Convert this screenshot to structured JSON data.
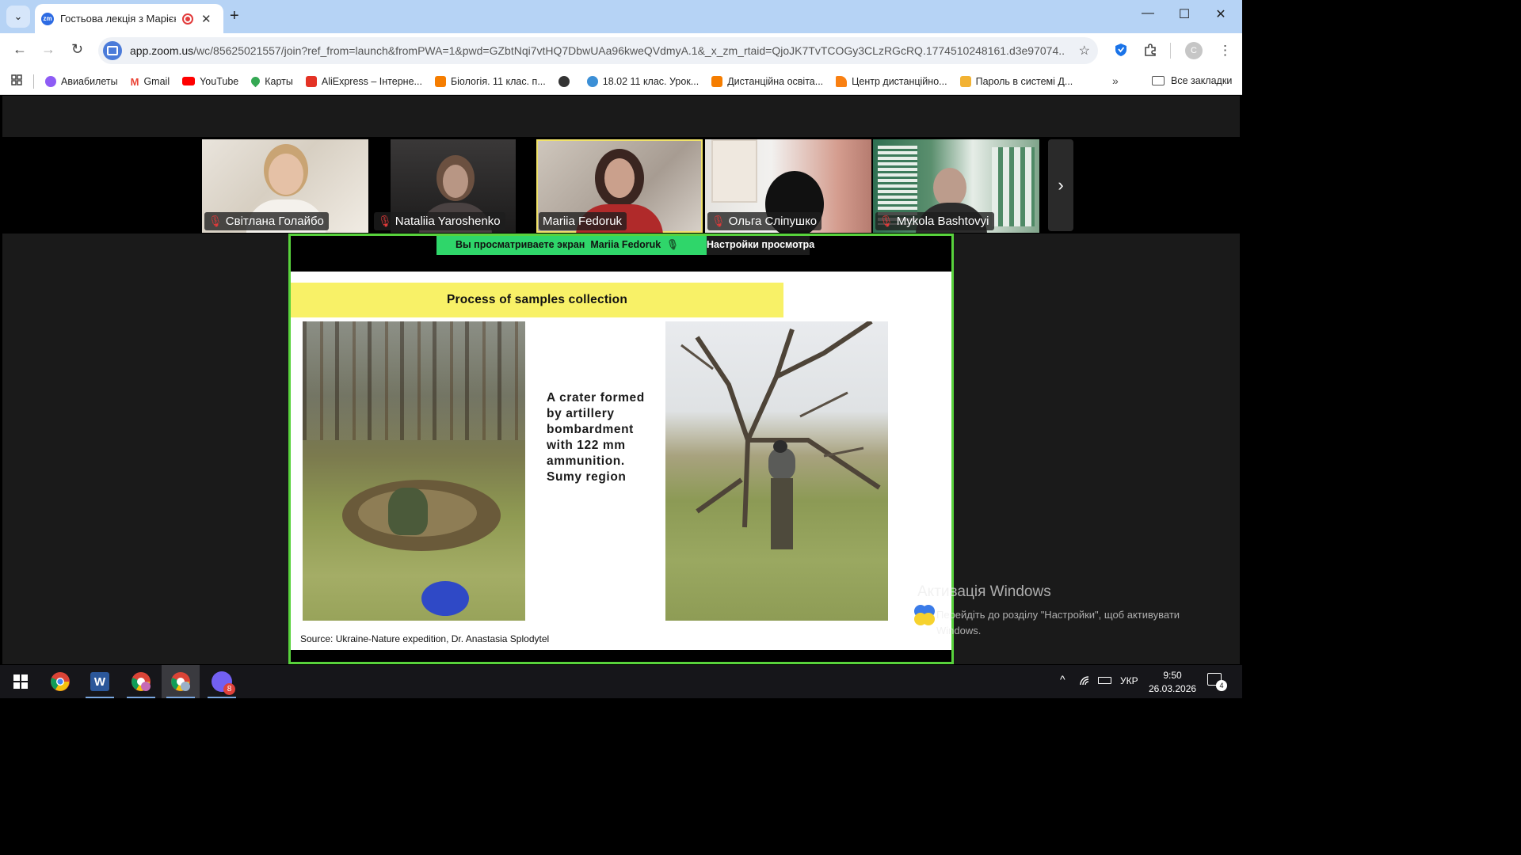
{
  "browser": {
    "tab_title": "Гостьова лекція з Марією",
    "tab_favicon": "zm",
    "new_tab": "+",
    "url_host": "app.zoom.us",
    "url_path": "/wc/85625021557/join?ref_from=launch&fromPWA=1&pwd=GZbtNqi7vtHQ7DbwUAa96kweQVdmyA.1&_x_zm_rtaid=QjoJK7TvTCOGy3CLzRGcRQ.1774510248161.d3e97074...",
    "profile_initial": "C"
  },
  "bookmarks": {
    "items": [
      {
        "label": "Авиабилеты",
        "icon": "aviasales-icon",
        "color": "#8e5cf5"
      },
      {
        "label": "Gmail",
        "icon": "gmail-icon",
        "color": "#ea4335"
      },
      {
        "label": "YouTube",
        "icon": "youtube-icon",
        "color": "#ff0000"
      },
      {
        "label": "Карты",
        "icon": "maps-pin-icon",
        "color": "#34a853"
      },
      {
        "label": "AliExpress – Інтерне...",
        "icon": "aliexpress-icon",
        "color": "#e43225"
      },
      {
        "label": "Біологія. 11 клас. п...",
        "icon": "blogger-icon",
        "color": "#f57d00"
      },
      {
        "label": "",
        "icon": "globe-icon",
        "color": "#333333"
      },
      {
        "label": "18.02 11 клас. Урок...",
        "icon": "wordpress-icon",
        "color": "#3b8fd6"
      },
      {
        "label": "Дистанційна освіта...",
        "icon": "blogger-icon",
        "color": "#f57d00"
      },
      {
        "label": "Центр дистанційно...",
        "icon": "moodle-icon",
        "color": "#f98012"
      },
      {
        "label": "Пароль в системі Д...",
        "icon": "lock-page-icon",
        "color": "#f2b233"
      }
    ],
    "more": "»",
    "all_label": "Все закладки"
  },
  "participants": [
    {
      "name": "Світлана Голайбо",
      "muted": true
    },
    {
      "name": "Nataliia Yaroshenko",
      "muted": true
    },
    {
      "name": "Mariia Fedoruk",
      "muted": false,
      "active_speaker": true
    },
    {
      "name": "Ольга Сліпушко",
      "muted": true
    },
    {
      "name": "Mykola Bashtovyi",
      "muted": true
    }
  ],
  "share_bar": {
    "viewing_prefix": "Вы просматриваете экран",
    "presenter": "Mariia Fedoruk",
    "settings_label": "Настройки просмотра"
  },
  "slide": {
    "title": "Process of samples collection",
    "caption_lines": [
      "A crater formed",
      "by artillery",
      "bombardment",
      "with 122 mm",
      "ammunition.",
      "Sumy region"
    ],
    "source": "Source: Ukraine-Nature expedition, Dr. Anastasia Splodytel"
  },
  "windows_activation": {
    "title": "Активація Windows",
    "subtitle": "Перейдіть до розділу \"Настройки\", щоб активувати Windows."
  },
  "taskbar": {
    "apps": [
      "chrome",
      "word",
      "chrome-profile-c",
      "chrome-profile-c-active",
      "viber"
    ],
    "viber_badge": "8",
    "language": "УКР",
    "time": "9:50",
    "date": "26.03.2026",
    "notifications_count": "4"
  }
}
